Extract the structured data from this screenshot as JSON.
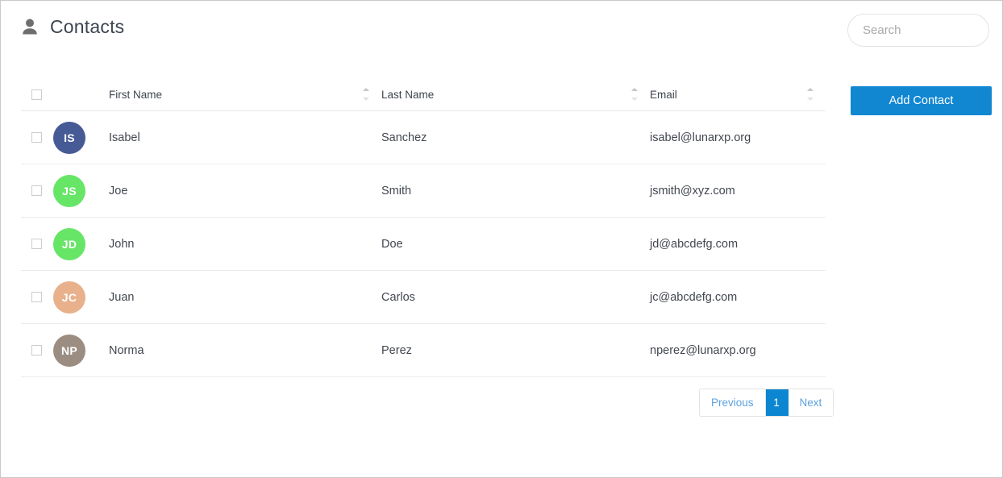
{
  "header": {
    "title": "Contacts",
    "icon": "person-icon"
  },
  "search": {
    "placeholder": "Search",
    "value": "",
    "icon": "search-icon"
  },
  "actions": {
    "add_contact_label": "Add Contact",
    "add_contact_color": "#1187d2"
  },
  "table": {
    "columns": [
      {
        "label": "First Name",
        "sortable": true
      },
      {
        "label": "Last Name",
        "sortable": true
      },
      {
        "label": "Email",
        "sortable": true
      }
    ],
    "rows": [
      {
        "initials": "IS",
        "avatar_color": "#465a96",
        "first_name": "Isabel",
        "last_name": "Sanchez",
        "email": "isabel@lunarxp.org",
        "selected": false
      },
      {
        "initials": "JS",
        "avatar_color": "#67e567",
        "first_name": "Joe",
        "last_name": "Smith",
        "email": "jsmith@xyz.com",
        "selected": false
      },
      {
        "initials": "JD",
        "avatar_color": "#67e567",
        "first_name": "John",
        "last_name": "Doe",
        "email": "jd@abcdefg.com",
        "selected": false
      },
      {
        "initials": "JC",
        "avatar_color": "#e8b18c",
        "first_name": "Juan",
        "last_name": "Carlos",
        "email": "jc@abcdefg.com",
        "selected": false
      },
      {
        "initials": "NP",
        "avatar_color": "#9b8d82",
        "first_name": "Norma",
        "last_name": "Perez",
        "email": "nperez@lunarxp.org",
        "selected": false
      }
    ]
  },
  "pagination": {
    "previous_label": "Previous",
    "next_label": "Next",
    "pages": [
      "1"
    ],
    "current_page": "1",
    "active_color": "#0d86d1",
    "link_color": "#5da2e0"
  }
}
